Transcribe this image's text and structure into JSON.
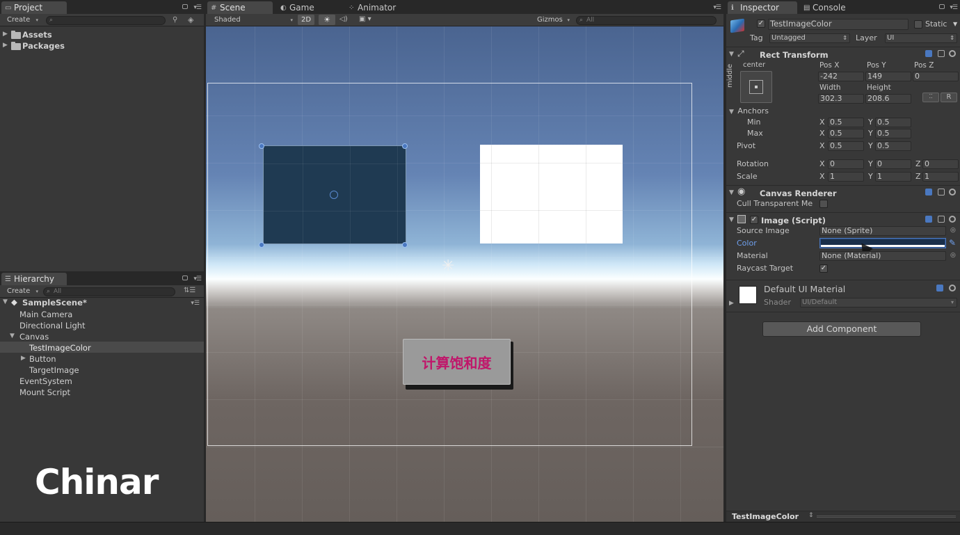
{
  "project": {
    "tab": "Project",
    "create_label": "Create",
    "items": [
      "Assets",
      "Packages"
    ]
  },
  "hierarchy": {
    "tab": "Hierarchy",
    "create_label": "Create",
    "search_placeholder": "All",
    "scene": "SampleScene*",
    "items": [
      "Main Camera",
      "Directional Light",
      "Canvas",
      "TestImageColor",
      "Button",
      "TargetImage",
      "EventSystem",
      "Mount Script"
    ]
  },
  "scene": {
    "tabs": [
      "Scene",
      "Game",
      "Animator"
    ],
    "shading": "Shaded",
    "mode_2d": "2D",
    "gizmos": "Gizmos",
    "search_placeholder": "All",
    "button_text": "计算饱和度"
  },
  "inspector": {
    "tabs": [
      "Inspector",
      "Console"
    ],
    "object_name": "TestImageColor",
    "static_label": "Static",
    "tag_label": "Tag",
    "tag_value": "Untagged",
    "layer_label": "Layer",
    "layer_value": "UI",
    "rect_transform": {
      "title": "Rect Transform",
      "anchor_h": "center",
      "anchor_v": "middle",
      "pos_x_label": "Pos X",
      "pos_y_label": "Pos Y",
      "pos_z_label": "Pos Z",
      "pos_x": "-242",
      "pos_y": "149",
      "pos_z": "0",
      "width_label": "Width",
      "height_label": "Height",
      "width": "302.3",
      "height": "208.6",
      "r_label": "R",
      "anchors_label": "Anchors",
      "min_label": "Min",
      "max_label": "Max",
      "min_x": "0.5",
      "min_y": "0.5",
      "max_x": "0.5",
      "max_y": "0.5",
      "pivot_label": "Pivot",
      "pivot_x": "0.5",
      "pivot_y": "0.5",
      "rotation_label": "Rotation",
      "rot_x": "0",
      "rot_y": "0",
      "rot_z": "0",
      "scale_label": "Scale",
      "scale_x": "1",
      "scale_y": "1",
      "scale_z": "1",
      "x": "X",
      "y": "Y",
      "z": "Z"
    },
    "canvas_renderer": {
      "title": "Canvas Renderer",
      "cull_label": "Cull Transparent Me"
    },
    "image": {
      "title": "Image (Script)",
      "source_label": "Source Image",
      "source_value": "None (Sprite)",
      "color_label": "Color",
      "material_label": "Material",
      "material_value": "None (Material)",
      "raycast_label": "Raycast Target"
    },
    "material": {
      "name": "Default UI Material",
      "shader_label": "Shader",
      "shader_value": "UI/Default"
    },
    "add_component": "Add Component",
    "footer": "TestImageColor"
  },
  "watermark": "Chinar",
  "colors": {
    "accent_blue": "#4a78c0",
    "button_text": "#c0166a",
    "dark_image": "#1f3a52"
  }
}
